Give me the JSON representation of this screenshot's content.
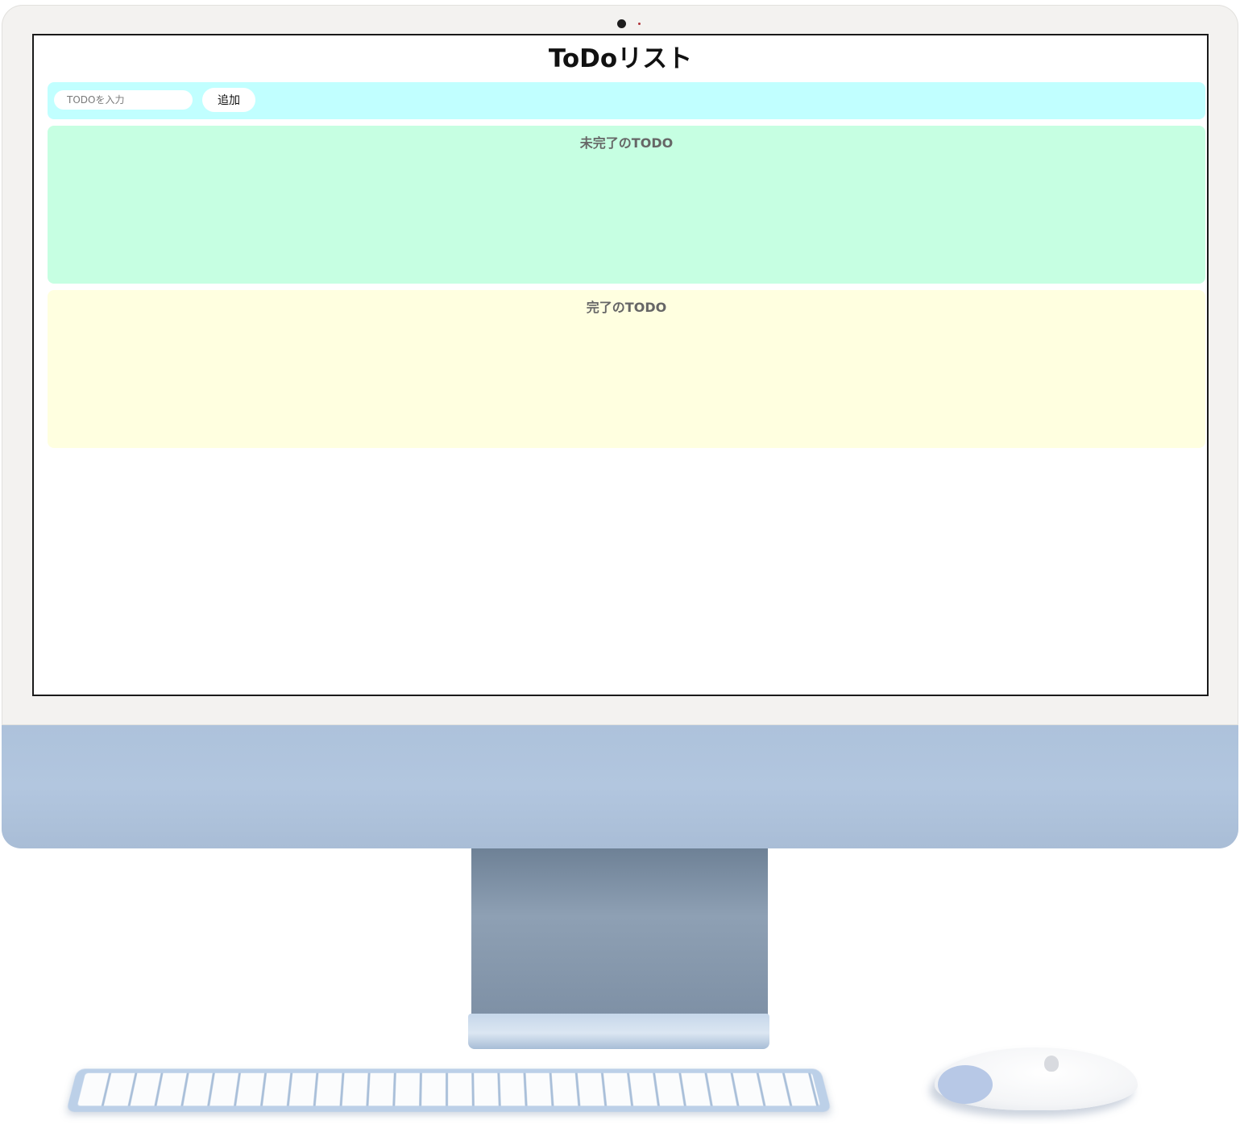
{
  "app": {
    "title": "ToDoリスト"
  },
  "input_area": {
    "placeholder": "TODOを入力",
    "value": "",
    "add_label": "追加",
    "background": "#c1ffff"
  },
  "incomplete_area": {
    "title": "未完了のTODO",
    "items": [],
    "background": "#c6ffe2"
  },
  "complete_area": {
    "title": "完了のTODO",
    "items": [],
    "background": "#ffffe0"
  },
  "device": {
    "color": "#adc2db"
  }
}
